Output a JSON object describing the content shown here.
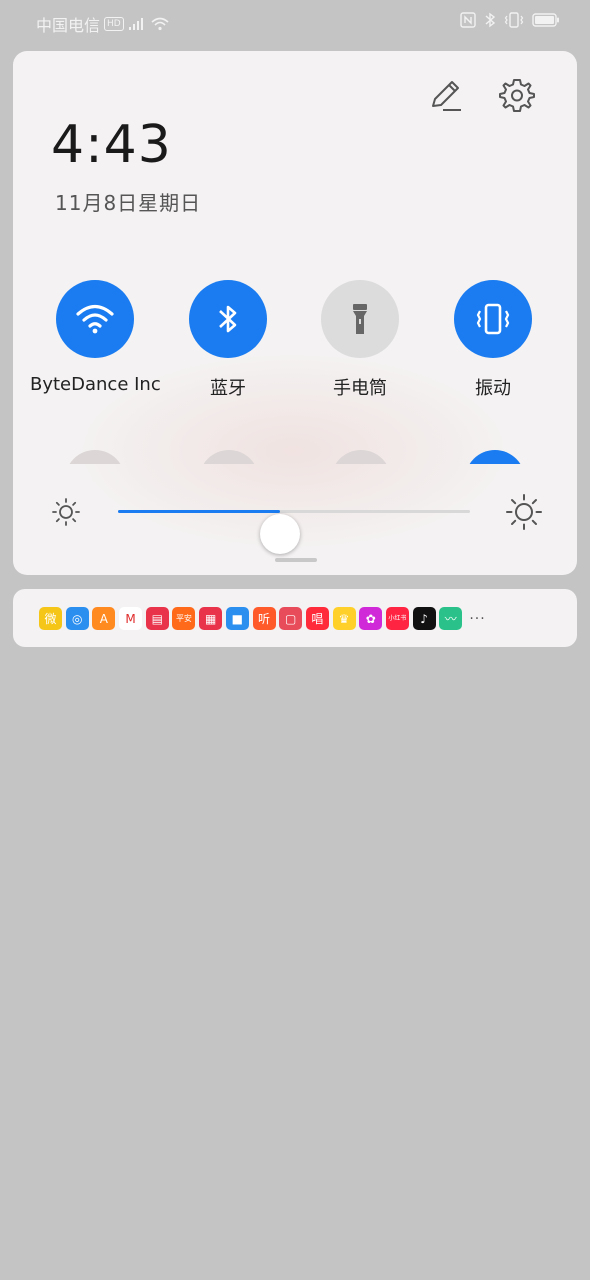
{
  "status_bar": {
    "carrier": "中国电信",
    "hd_badge": "HD",
    "network_icons": [
      "signal-icon",
      "wifi-icon"
    ],
    "right_icons": [
      "nfc-icon",
      "bluetooth-icon",
      "vibrate-icon",
      "battery-icon"
    ]
  },
  "panel": {
    "time": "4:43",
    "date": "11月8日星期日",
    "tiles": [
      {
        "label": "ByteDance Inc",
        "icon": "wifi-icon",
        "state": "on"
      },
      {
        "label": "蓝牙",
        "icon": "bluetooth-icon",
        "state": "on"
      },
      {
        "label": "手电筒",
        "icon": "flashlight-icon",
        "state": "off"
      },
      {
        "label": "振动",
        "icon": "vibrate-icon",
        "state": "on"
      }
    ],
    "brightness_level": 0.46
  },
  "notifications": {
    "apps": [
      {
        "name": "weibo-icon",
        "bg": "#f5c518",
        "text": "微"
      },
      {
        "name": "app-blue-ring-icon",
        "bg": "#2b8ff0",
        "text": "◎"
      },
      {
        "name": "app-orange-icon",
        "bg": "#ff8a1f",
        "text": "A"
      },
      {
        "name": "app-red-m-icon",
        "bg": "#ffffff",
        "text": "M"
      },
      {
        "name": "app-red-card-icon",
        "bg": "#e8334a",
        "text": "▤"
      },
      {
        "name": "pingan-securities-icon",
        "bg": "#ff6a1a",
        "text": "平安"
      },
      {
        "name": "app-pink-icon",
        "bg": "#e8334a",
        "text": "▦"
      },
      {
        "name": "app-blue-chat-icon",
        "bg": "#2b8ff0",
        "text": "■"
      },
      {
        "name": "ting-icon",
        "bg": "#ff5a2a",
        "text": "听"
      },
      {
        "name": "app-red-book-icon",
        "bg": "#e84b5a",
        "text": "▢"
      },
      {
        "name": "chang-icon",
        "bg": "#ff2a3a",
        "text": "唱"
      },
      {
        "name": "app-yellow-icon",
        "bg": "#ffd02a",
        "text": "♛"
      },
      {
        "name": "app-magenta-icon",
        "bg": "#d02ad8",
        "text": "✿"
      },
      {
        "name": "xiaohongshu-icon",
        "bg": "#ff2442",
        "text": "小红书"
      },
      {
        "name": "tiktok-icon",
        "bg": "#111111",
        "text": "♪"
      },
      {
        "name": "app-green-icon",
        "bg": "#2ac28a",
        "text": "〰"
      }
    ],
    "more": "···"
  }
}
